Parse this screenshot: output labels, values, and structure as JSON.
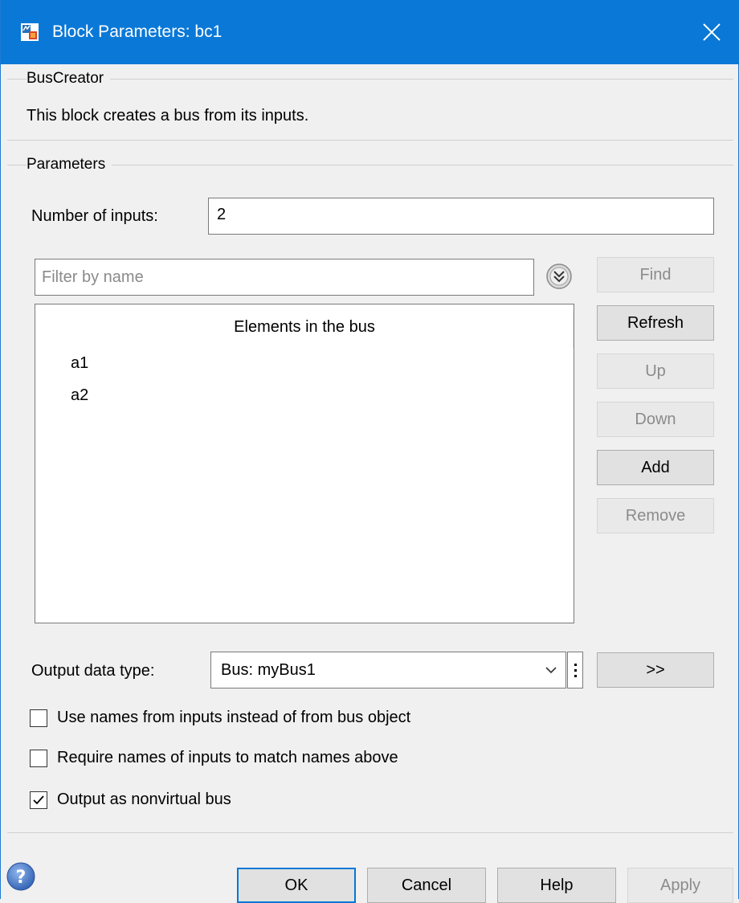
{
  "window": {
    "title": "Block Parameters: bc1"
  },
  "block": {
    "group_label": "BusCreator",
    "description": "This block creates a bus from its inputs."
  },
  "parameters": {
    "group_label": "Parameters",
    "num_inputs_label": "Number of inputs:",
    "num_inputs_value": "2",
    "filter_placeholder": "Filter by name",
    "list_header": "Elements in the bus",
    "elements": [
      "a1",
      "a2"
    ],
    "side_buttons": {
      "find": "Find",
      "refresh": "Refresh",
      "up": "Up",
      "down": "Down",
      "add": "Add",
      "remove": "Remove"
    },
    "output_type_label": "Output data type:",
    "output_type_value": "Bus: myBus1",
    "assistant_button": ">>",
    "checkboxes": [
      {
        "label": "Use names from inputs instead of from bus object",
        "checked": false
      },
      {
        "label": "Require names of inputs to match names above",
        "checked": false
      },
      {
        "label": "Output as nonvirtual bus",
        "checked": true
      }
    ]
  },
  "footer": {
    "ok": "OK",
    "cancel": "Cancel",
    "help": "Help",
    "apply": "Apply"
  },
  "colors": {
    "titlebar": "#0a78d7",
    "dialog_bg": "#f0f0f0",
    "default_button_border": "#0078d7",
    "disabled_text": "#8b8b8b"
  },
  "icons": {
    "title": "simulink-block-icon",
    "close": "close-icon",
    "filter_options": "chevron-double-down-icon",
    "combo_dropdown": "chevron-down-icon",
    "kebab": "vertical-ellipsis-icon",
    "help": "help-icon"
  }
}
